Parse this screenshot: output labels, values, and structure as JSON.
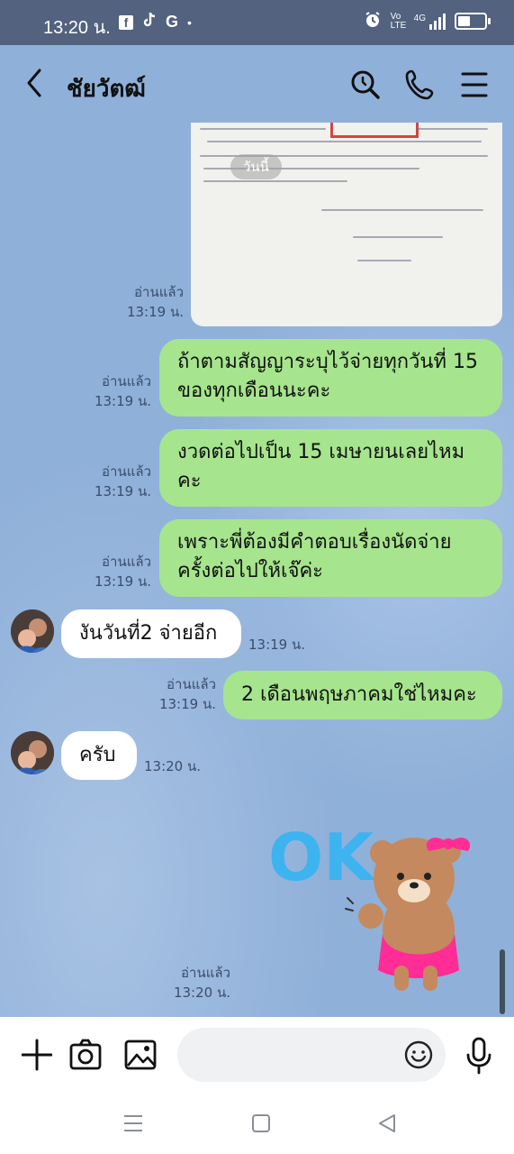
{
  "status_bar": {
    "time": "13:20 น.",
    "notifications": [
      "f",
      "tiktok",
      "G",
      "•"
    ],
    "network": "4G",
    "volte": "Vo LTE",
    "battery_level": 0.55
  },
  "header": {
    "contact_name": "ชัยวัตฒ์"
  },
  "chat": {
    "date_badge": "วันนี้",
    "photo": {
      "read_label": "อ่านแล้ว",
      "time": "13:19 น."
    },
    "messages": [
      {
        "text": "ถ้าตามสัญญาระบุไว้จ่ายทุกวันที่ 15 ของทุกเดือนนะคะ",
        "read_label": "อ่านแล้ว",
        "time": "13:19 น."
      },
      {
        "text": "งวดต่อไปเป็น 15 เมษายนเลยไหมคะ",
        "read_label": "อ่านแล้ว",
        "time": "13:19 น."
      },
      {
        "text": "เพราะพี่ต้องมีคำตอบเรื่องนัดจ่ายครั้งต่อไปให้เจ๊ค่ะ",
        "read_label": "อ่านแล้ว",
        "time": "13:19 น."
      },
      {
        "text": "งันวันที่2 จ่ายอีก",
        "time": "13:19 น."
      },
      {
        "text": "2 เดือนพฤษภาคมใช่ไหมคะ",
        "read_label": "อ่านแล้ว",
        "time": "13:19 น."
      },
      {
        "text": "ครับ",
        "time": "13:20 น."
      }
    ],
    "sticker": {
      "text": "OK",
      "read_label": "อ่านแล้ว",
      "time": "13:20 น."
    }
  },
  "colors": {
    "chat_bg": "#8fb0d9",
    "outgoing_bubble": "#a6e58d",
    "incoming_bubble": "#ffffff",
    "status_bar": "#52627f"
  }
}
